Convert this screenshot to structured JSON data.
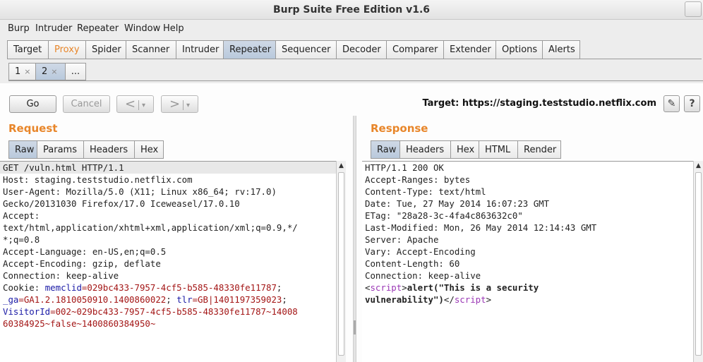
{
  "window": {
    "title": "Burp Suite Free Edition v1.6"
  },
  "menu": [
    "Burp",
    "Intruder",
    "Repeater",
    "Window",
    "Help"
  ],
  "main_tabs": [
    "Target",
    "Proxy",
    "Spider",
    "Scanner",
    "Intruder",
    "Repeater",
    "Sequencer",
    "Decoder",
    "Comparer",
    "Extender",
    "Options",
    "Alerts"
  ],
  "active_main_tab": "Repeater",
  "repeater_tabs": [
    {
      "label": "1",
      "close": "×"
    },
    {
      "label": "2",
      "close": "×"
    },
    {
      "label": "..."
    }
  ],
  "toolbar": {
    "go": "Go",
    "cancel": "Cancel",
    "back": "<",
    "forward": ">",
    "dropdown": "▾",
    "target_label": "Target: https://staging.teststudio.netflix.com",
    "edit_icon": "✎",
    "help_icon": "?"
  },
  "request": {
    "title": "Request",
    "tabs": [
      "Raw",
      "Params",
      "Headers",
      "Hex"
    ],
    "lines": [
      "GET /vuln.html HTTP/1.1",
      "Host: staging.teststudio.netflix.com",
      "User-Agent: Mozilla/5.0 (X11; Linux x86_64; rv:17.0)",
      "Gecko/20131030 Firefox/17.0 Iceweasel/17.0.10",
      "Accept:",
      "text/html,application/xhtml+xml,application/xml;q=0.9,*/",
      "*;q=0.8",
      "Accept-Language: en-US,en;q=0.5",
      "Accept-Encoding: gzip, deflate",
      "Connection: keep-alive"
    ],
    "cookie": {
      "label": "Cookie: ",
      "l1k1": "memclid",
      "l1v1": "=029bc433-7957-4cf5-b585-48330fe11787",
      "l1s": ";",
      "l2k1": "_ga",
      "l2v1": "=GA1.2.1810050910.1400860022",
      "l2s1": "; ",
      "l2k2": "tlr",
      "l2v2": "=GB|1401197359023",
      "l2s2": ";",
      "l3k1": "VisitorId",
      "l3v1": "=002~029bc433-7957-4cf5-b585-48330fe11787~14008",
      "l4v1": "60384925~false~1400860384950~"
    }
  },
  "response": {
    "title": "Response",
    "tabs": [
      "Raw",
      "Headers",
      "Hex",
      "HTML",
      "Render"
    ],
    "lines": [
      "HTTP/1.1 200 OK",
      "Accept-Ranges: bytes",
      "Content-Type: text/html",
      "Date: Tue, 27 May 2014 16:07:23 GMT",
      "ETag: \"28a28-3c-4fa4c863632c0\"",
      "Last-Modified: Mon, 26 May 2014 12:14:43 GMT",
      "Server: Apache",
      "Vary: Accept-Encoding",
      "Content-Length: 60",
      "Connection: keep-alive",
      ""
    ],
    "script": {
      "open_lt": "<",
      "open_tag": "script",
      "open_gt": ">",
      "body1": "alert(\"This is a security",
      "body2": "vulnerability\")",
      "close_lt": "</",
      "close_tag": "script",
      "close_gt": ">"
    }
  },
  "scroll_arrow": "▲"
}
